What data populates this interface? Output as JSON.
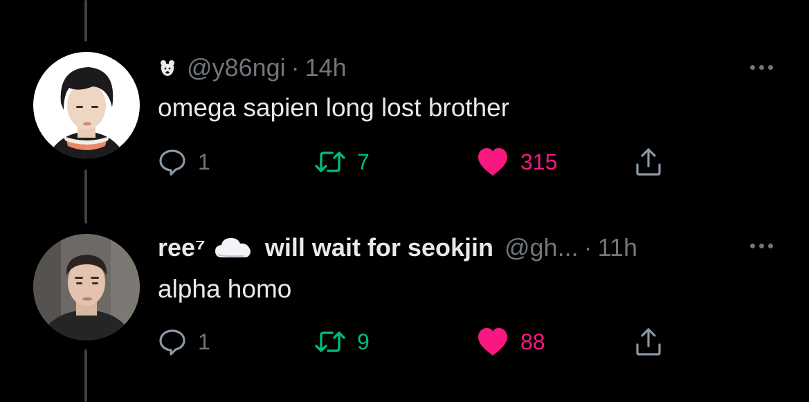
{
  "colors": {
    "background": "#000000",
    "text_primary": "#e7e9ea",
    "text_secondary": "#71767b",
    "retweet_green": "#00ba7c",
    "like_pink": "#f91880",
    "thread_line": "#3d4145"
  },
  "tweets": [
    {
      "display_name": "",
      "badge_icon": "bear-emoji-icon",
      "handle": "@y86ngi",
      "separator": "·",
      "time": "14h",
      "text": "omega sapien long lost brother",
      "reply_count": "1",
      "retweet_count": "7",
      "like_count": "315",
      "liked": true
    },
    {
      "display_name": "ree⁷",
      "badge_icon": "cloud-emoji-icon",
      "name_suffix": "will wait for seokjin",
      "handle": "@gh...",
      "separator": "·",
      "time": "11h",
      "text": "alpha homo",
      "reply_count": "1",
      "retweet_count": "9",
      "like_count": "88",
      "liked": true
    }
  ]
}
